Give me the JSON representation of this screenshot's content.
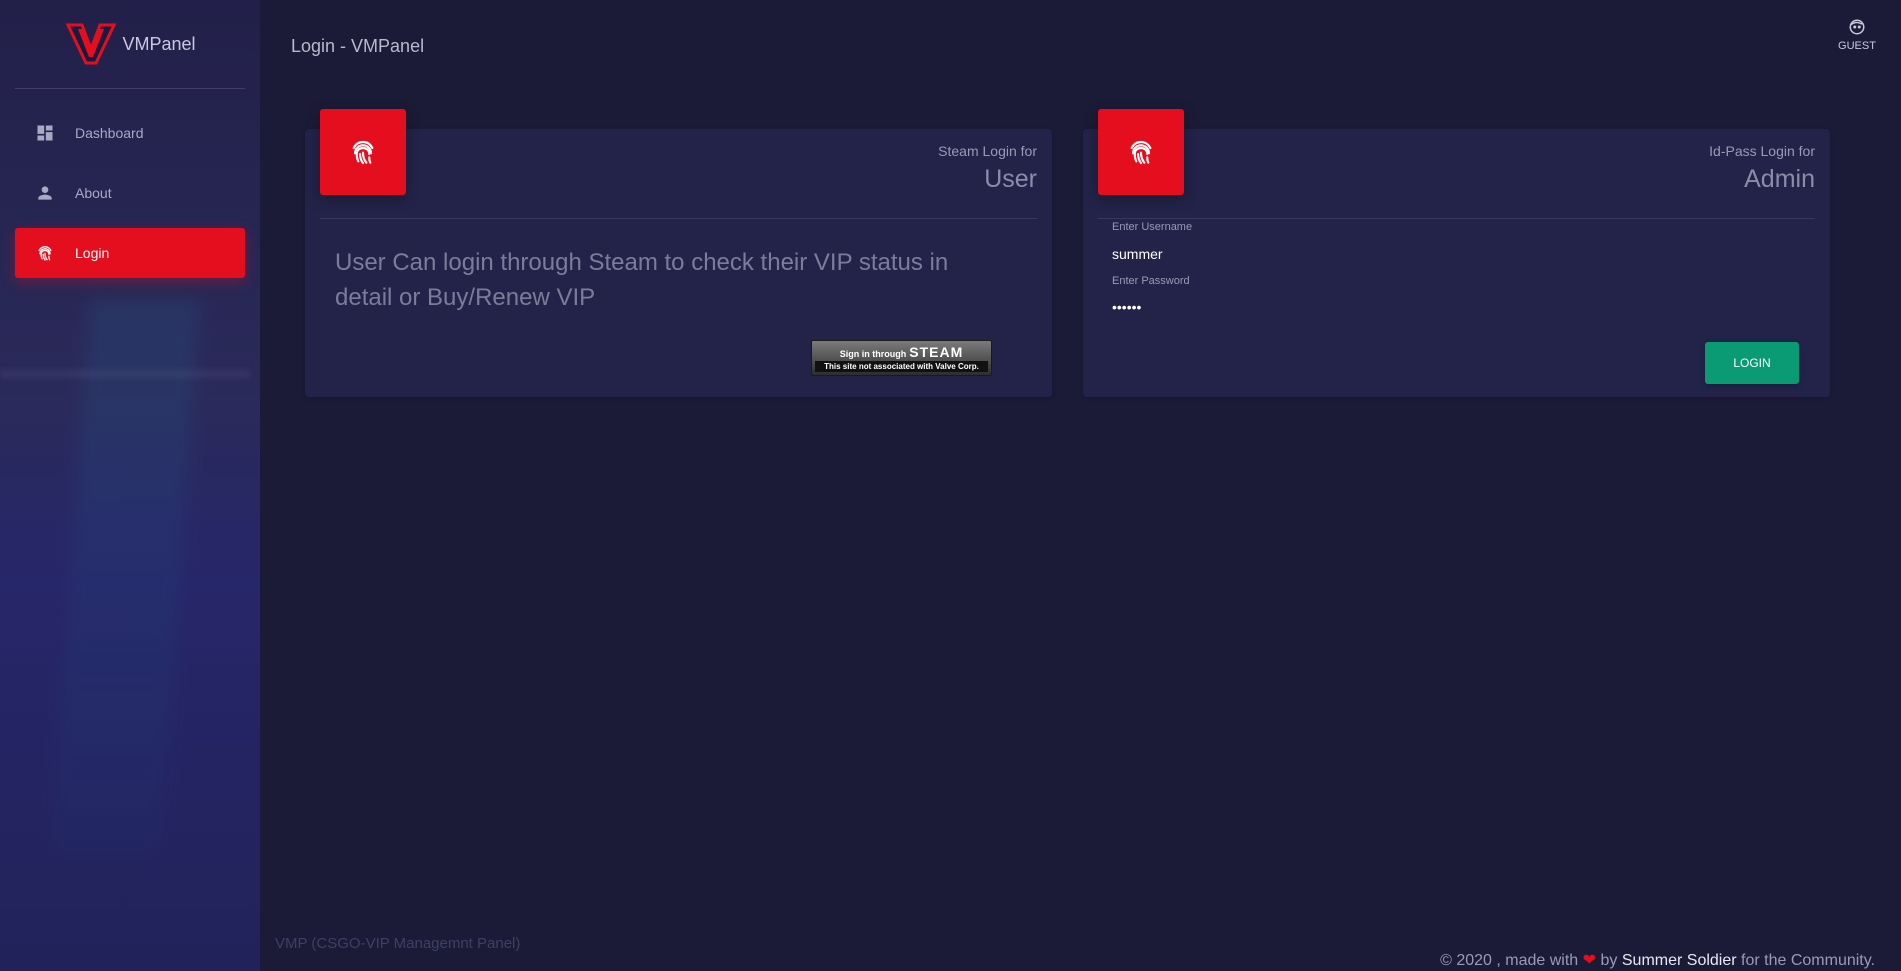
{
  "brand": {
    "name": "VMPanel",
    "logo_icon": "vmpanel-v-logo"
  },
  "sidebar": {
    "items": [
      {
        "label": "Dashboard",
        "icon": "dashboard-icon",
        "active": false
      },
      {
        "label": "About",
        "icon": "person-icon",
        "active": false
      },
      {
        "label": "Login",
        "icon": "fingerprint-icon",
        "active": true
      }
    ]
  },
  "header": {
    "title": "Login - VMPanel",
    "user_label": "GUEST",
    "user_icon": "face-icon"
  },
  "user_card": {
    "category": "Steam Login for",
    "title": "User",
    "description": "User Can login through Steam to check their VIP status in detail or Buy/Renew VIP",
    "steam_button": {
      "top_text": "Sign in through",
      "brand_text": "STEAM",
      "bottom_text": "This site not associated with Valve Corp."
    }
  },
  "admin_card": {
    "category": "Id-Pass Login for",
    "title": "Admin",
    "username_label": "Enter Username",
    "username_value": "summer",
    "password_label": "Enter Password",
    "password_value": "••••••",
    "login_label": "LOGIN"
  },
  "footer": {
    "left": "VMP (CSGO-VIP Managemnt Panel)",
    "right_prefix": "© 2020 , made with",
    "right_by": "by",
    "author": "Summer Soldier",
    "right_suffix": "for the Community."
  },
  "colors": {
    "accent": "#e40e1e",
    "success": "#0a9a74",
    "background": "#1b1b37",
    "card": "#23234a"
  }
}
